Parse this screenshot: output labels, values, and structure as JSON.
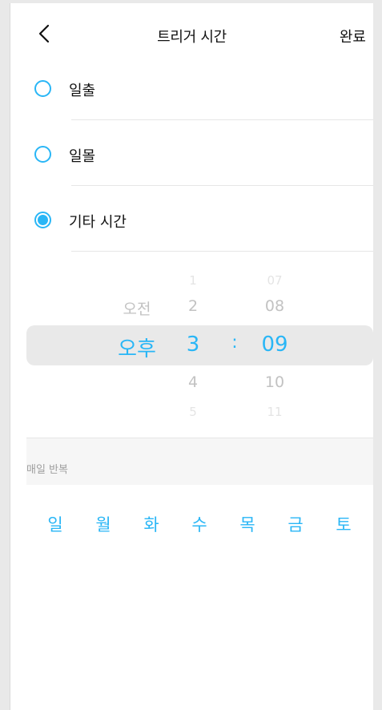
{
  "header": {
    "back_icon": "chevron-left-icon",
    "title": "트리거 시간",
    "done_label": "완료"
  },
  "options": [
    {
      "label": "일출",
      "selected": false
    },
    {
      "label": "일몰",
      "selected": false
    },
    {
      "label": "기타 시간",
      "selected": true
    }
  ],
  "time_picker": {
    "ampm": {
      "above": "오전",
      "selected": "오후"
    },
    "hour": {
      "far_above": "1",
      "above": "2",
      "selected": "3",
      "below": "4",
      "far_below": "5"
    },
    "separator": ":",
    "minute": {
      "far_above": "07",
      "above": "08",
      "selected": "09",
      "below": "10",
      "far_below": "11"
    }
  },
  "repeat": {
    "label": "매일 반복",
    "days": [
      "일",
      "월",
      "화",
      "수",
      "목",
      "금",
      "토"
    ]
  },
  "colors": {
    "accent": "#29b6f6",
    "highlight_band": "#e9e9e9"
  }
}
